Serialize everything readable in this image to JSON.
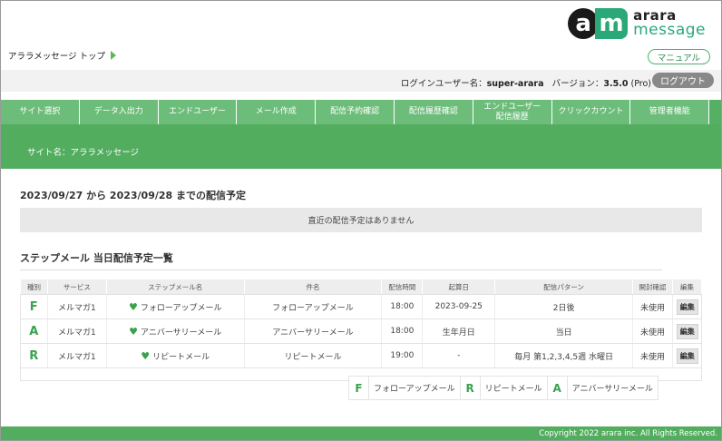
{
  "logo": {
    "mark_a": "a",
    "mark_m": "m",
    "line1": "arara",
    "line2": "message"
  },
  "breadcrumb": {
    "label": "アララメッセージ トップ"
  },
  "header": {
    "manual_label": "マニュアル",
    "user_label": "ログインユーザー名：",
    "user_name": "super-arara",
    "version_label": "バージョン：",
    "version": "3.5.0",
    "edition": "(Pro)",
    "logout_label": "ログアウト"
  },
  "nav": {
    "items": [
      {
        "label": "サイト選択"
      },
      {
        "label": "データ入出力"
      },
      {
        "label": "エンドユーザー"
      },
      {
        "label": "メール作成"
      },
      {
        "label": "配信予約確認"
      },
      {
        "label": "配信履歴確認"
      },
      {
        "label": "エンドユーザー\n配信履歴"
      },
      {
        "label": "クリックカウント"
      },
      {
        "label": "管理者機能"
      }
    ]
  },
  "site": {
    "name_label": "サイト名：アララメッセージ"
  },
  "schedule": {
    "title": "2023/09/27 から 2023/09/28 までの配信予定",
    "empty_message": "直近の配信予定はありません"
  },
  "steps": {
    "title": "ステップメール 当日配信予定一覧",
    "headers": [
      "種別",
      "サービス",
      "ステップメール名",
      "件名",
      "配信時間",
      "起算日",
      "配信パターン",
      "開封確認",
      "編集"
    ],
    "rows": [
      {
        "type": "F",
        "service": "メルマガ1",
        "name": "フォローアップメール",
        "subject": "フォローアップメール",
        "time": "18:00",
        "base_date": "2023-09-25",
        "pattern": "2日後",
        "open": "未使用",
        "edit": "編集"
      },
      {
        "type": "A",
        "service": "メルマガ1",
        "name": "アニバーサリーメール",
        "subject": "アニバーサリーメール",
        "time": "18:00",
        "base_date": "生年月日",
        "pattern": "当日",
        "open": "未使用",
        "edit": "編集"
      },
      {
        "type": "R",
        "service": "メルマガ1",
        "name": "リピートメール",
        "subject": "リピートメール",
        "time": "19:00",
        "base_date": "-",
        "pattern": "毎月 第1,2,3,4,5週 水曜日",
        "open": "未使用",
        "edit": "編集"
      }
    ],
    "legend": [
      {
        "letter": "F",
        "label": "フォローアップメール"
      },
      {
        "letter": "R",
        "label": "リピートメール"
      },
      {
        "letter": "A",
        "label": "アニバーサリーメール"
      }
    ]
  },
  "footer": {
    "copyright": "Copyright 2022 arara inc. All Rights Reserved."
  },
  "colors": {
    "accent_green": "#53ad5f",
    "nav_green": "#6dbd7a",
    "logo_green": "#2aa878",
    "logout_gray": "#888888"
  }
}
